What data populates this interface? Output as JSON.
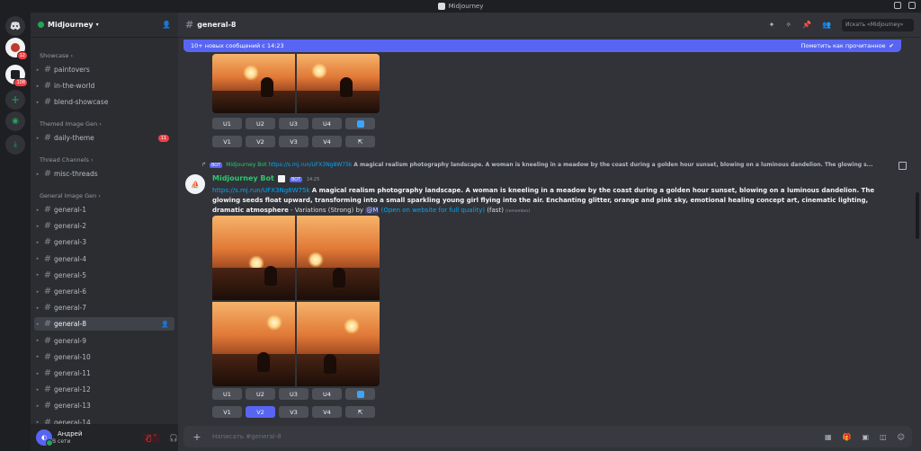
{
  "window": {
    "title": "Midjourney"
  },
  "rail": {
    "badge1": "12",
    "badge2": "108"
  },
  "server": {
    "name": "Midjourney",
    "chevron": "▾"
  },
  "categories": {
    "showcase": "Showcase",
    "themed": "Themed Image Gen",
    "thread": "Thread Channels",
    "general": "General Image Gen"
  },
  "channels_showcase": [
    "paintovers",
    "in-the-world",
    "blend-showcase"
  ],
  "channel_daily": {
    "name": "daily-theme",
    "badge": "11"
  },
  "channel_thread": "misc-threads",
  "channels_general": [
    "general-1",
    "general-2",
    "general-3",
    "general-4",
    "general-5",
    "general-6",
    "general-7",
    "general-8",
    "general-9",
    "general-10",
    "general-11",
    "general-12",
    "general-13",
    "general-14"
  ],
  "user": {
    "name": "Андрей",
    "status": "В сети"
  },
  "header": {
    "channel": "general-8",
    "search_placeholder": "Искать «Midjourney»"
  },
  "newbar": {
    "text": "10+ новых сообщений с 14:23",
    "mark": "Пометить как прочитанное"
  },
  "buttons_upscale": [
    "U1",
    "U2",
    "U3",
    "U4"
  ],
  "buttons_variation": [
    "V1",
    "V2",
    "V3",
    "V4"
  ],
  "reply": {
    "bot_tag": "BOT",
    "name": "Midjourney Bot",
    "link": "https://s.mj.run/UFX3Ng8W75k",
    "text": "A magical realism photography landscape. A woman is kneeling in a meadow by the coast during a golden hour sunset, blowing on a luminous dandelion. The glowing s..."
  },
  "message": {
    "author": "Midjourney Bot",
    "bot_tag": "BOT",
    "time": "14:25",
    "link": "https://s.mj.run/UFX3Ng8W75k",
    "prompt": "A magical realism photography landscape. A woman is kneeling in a meadow by the coast during a golden hour sunset, blowing on a luminous dandelion. The glowing seeds float upward, transforming into a small sparkling young girl flying into the air. Enchanting glitter, orange and pink sky, emotional healing concept art, cinematic lighting, dramatic atmosphere",
    "suffix": " - Variations (Strong) by ",
    "mention": "@M",
    "web": "(Open on website for full quality)",
    "speed": "(fast)",
    "tiny": "(remember)"
  },
  "composer": {
    "placeholder": "Написать #general-8"
  },
  "colors": {
    "accent": "#5865f2",
    "bot_name": "#2dc770",
    "link": "#00a8fc",
    "danger": "#f23f43"
  }
}
